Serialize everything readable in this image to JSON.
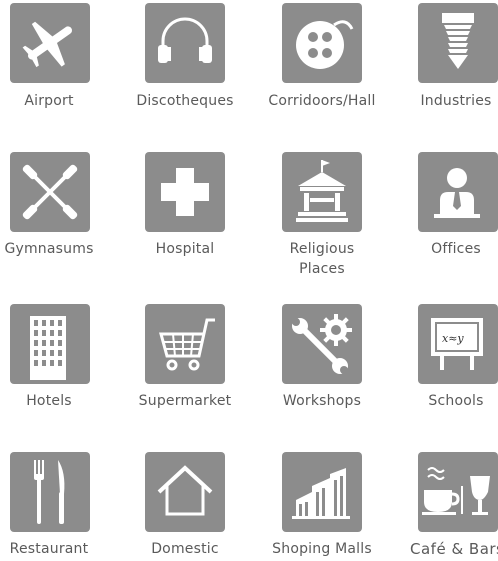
{
  "colors": {
    "tile": "#8c8c8c",
    "icon": "#ffffff",
    "label": "#5a5a5a"
  },
  "items": [
    {
      "label": "Airport",
      "icon": "airplane-icon"
    },
    {
      "label": "Discotheques",
      "icon": "headphones-icon"
    },
    {
      "label": "Corridoors/Hall",
      "icon": "film-reel-icon"
    },
    {
      "label": "Industries",
      "icon": "drill-bit-icon"
    },
    {
      "label": "Gymnasums",
      "icon": "dumbbells-icon"
    },
    {
      "label": "Hospital",
      "icon": "cross-icon"
    },
    {
      "label": "Religious\nPlaces",
      "icon": "temple-icon"
    },
    {
      "label": "Offices",
      "icon": "person-icon"
    },
    {
      "label": "Hotels",
      "icon": "building-icon"
    },
    {
      "label": "Supermarket",
      "icon": "shopping-cart-icon"
    },
    {
      "label": "Workshops",
      "icon": "wrench-gear-icon"
    },
    {
      "label": "Schools",
      "icon": "blackboard-icon"
    },
    {
      "label": "Restaurant",
      "icon": "fork-knife-icon"
    },
    {
      "label": "Domestic",
      "icon": "house-icon"
    },
    {
      "label": "Shoping Malls",
      "icon": "mall-icon"
    },
    {
      "label": "Café & Bars",
      "icon": "cup-glass-icon"
    }
  ]
}
